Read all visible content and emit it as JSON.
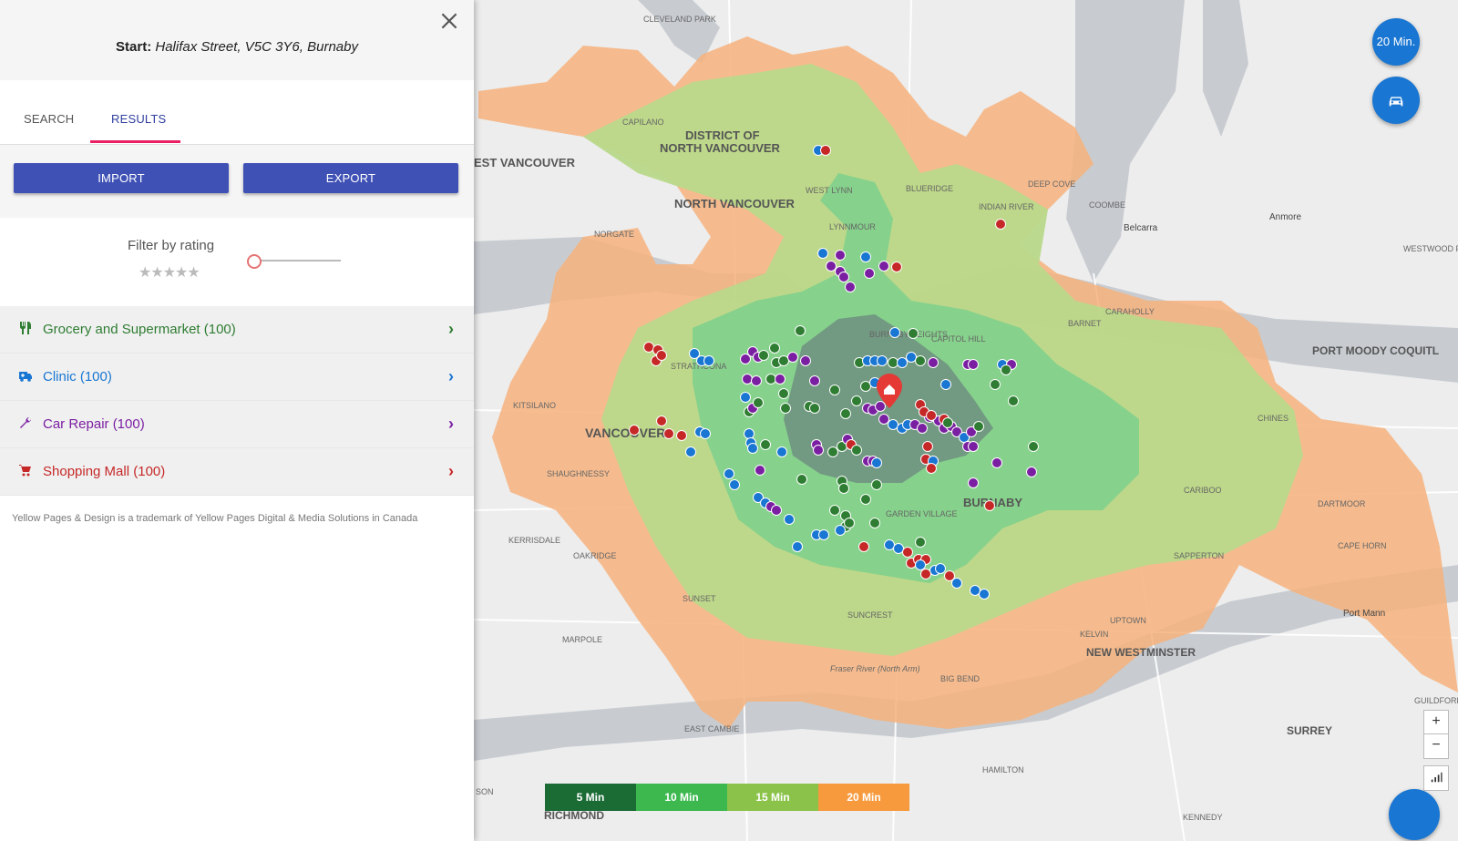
{
  "panel": {
    "start_label": "Start:",
    "start_address": "Halifax Street, V5C 3Y6, Burnaby",
    "tabs": [
      "SEARCH",
      "RESULTS"
    ],
    "active_tab": "RESULTS",
    "import_label": "IMPORT",
    "export_label": "EXPORT",
    "filter_label": "Filter by rating",
    "rating_stars": "★★★★★",
    "rating_value": 0,
    "categories": [
      {
        "label": "Grocery and Supermarket (100)",
        "color": "#2e7d32",
        "icon": "utensils-icon"
      },
      {
        "label": "Clinic (100)",
        "color": "#1976d2",
        "icon": "ambulance-icon"
      },
      {
        "label": "Car Repair (100)",
        "color": "#7b1fa2",
        "icon": "wrench-icon"
      },
      {
        "label": "Shopping Mall (100)",
        "color": "#c62828",
        "icon": "cart-icon"
      }
    ],
    "footer": "Yellow Pages & Design is a trademark of Yellow Pages Digital & Media Solutions in Canada"
  },
  "map": {
    "labels": [
      "CLEVELAND PARK",
      "CAPILANO",
      "DISTRICT OF",
      "NORTH VANCOUVER",
      "EST VANCOUVER",
      "NORTH VANCOUVER",
      "WEST LYNN",
      "BLUERIDGE",
      "DEEP COVE",
      "INDIAN RIVER",
      "COOMBE",
      "Belcarra",
      "Anmore",
      "WESTWOOD PLATEAU",
      "NORGATE",
      "LYNNMOUR",
      "CARAHOLLY",
      "BARNET",
      "PORT MOODY COQUITL",
      "BURNABY HEIGHTS",
      "CAPITOL HILL",
      "STRATHCONA",
      "KITSILANO",
      "VANCOUVER",
      "CHINES",
      "SHAUGHNESSY",
      "BURNABY",
      "CARIBOO",
      "DARTMOOR",
      "KERRISDALE",
      "OAKRIDGE",
      "GARDEN VILLAGE",
      "CAPE HORN",
      "SAPPERTON",
      "SUNSET",
      "SUNCREST",
      "Port Mann",
      "UPTOWN",
      "KELVIN",
      "MARPOLE",
      "NEW WESTMINSTER",
      "Fraser River (North Arm)",
      "BIG BEND",
      "GUILDFORD",
      "EAST CAMBIE",
      "SURREY",
      "HAMILTON",
      "SON",
      "RICHMOND",
      "KENNEDY"
    ],
    "travel_time_button": "20 Min.",
    "car_button_icon": "car-icon",
    "zoom_in": "+",
    "zoom_out": "−",
    "chart_icon": "signal-bars-icon",
    "legend": [
      {
        "label": "5 Min",
        "color": "#1b6b35"
      },
      {
        "label": "10 Min",
        "color": "#3cb84f"
      },
      {
        "label": "15 Min",
        "color": "#8bc34a"
      },
      {
        "label": "20 Min",
        "color": "#f79a3d"
      }
    ],
    "home_marker_icon": "home-icon"
  }
}
